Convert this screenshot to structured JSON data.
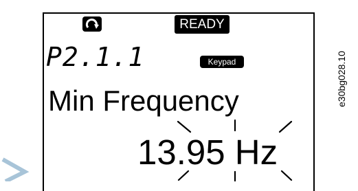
{
  "status": {
    "ready_label": "READY",
    "rotation_icon": "rotation-arrow-icon"
  },
  "parameter": {
    "code": "P2.1.1",
    "control_place": "Keypad",
    "name": "Min Frequency",
    "value": "13.95 Hz",
    "editing_indicator": "blinking-rays-icon"
  },
  "figure_code": "e30bg028.10",
  "colors": {
    "display_fg": "#000000",
    "display_bg": "#ffffff",
    "arrow": "#a8c4d8"
  }
}
